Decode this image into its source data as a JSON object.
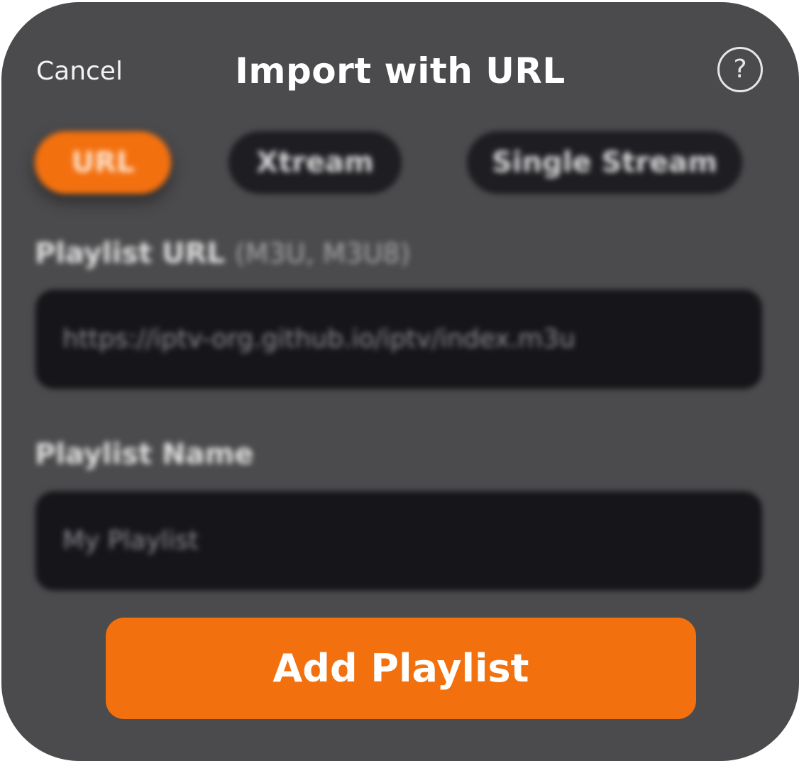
{
  "header": {
    "cancel_label": "Cancel",
    "title": "Import with URL",
    "help_symbol": "?"
  },
  "tabs": [
    {
      "label": "URL",
      "active": true
    },
    {
      "label": "Xtream",
      "active": false
    },
    {
      "label": "Single Stream",
      "active": false
    }
  ],
  "form": {
    "url_label": "Playlist URL",
    "url_hint": "(M3U, M3U8)",
    "url_value": "https://iptv-org.github.io/iptv/index.m3u",
    "name_label": "Playlist Name",
    "name_value": "My Playlist"
  },
  "submit_label": "Add Playlist",
  "colors": {
    "accent": "#f3700f",
    "panel": "#4b4b4d",
    "field": "#16161a"
  },
  "icons": {
    "help": "help-icon"
  }
}
